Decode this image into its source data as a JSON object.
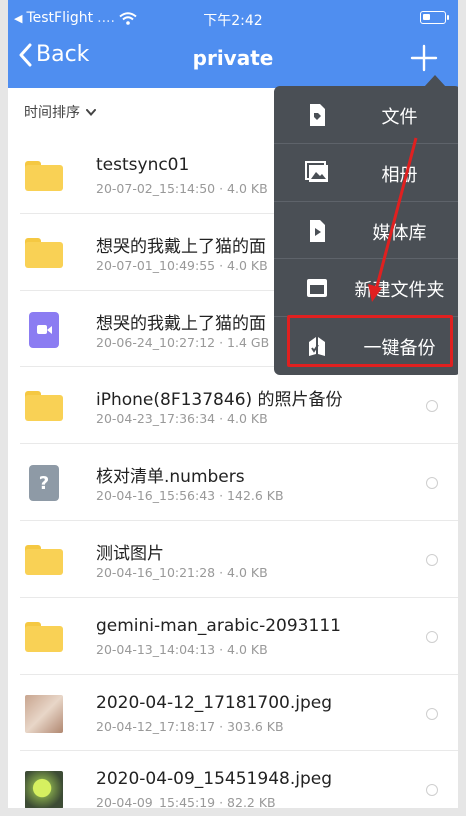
{
  "status_bar": {
    "carrier": "TestFlight",
    "signal": "....",
    "time": "下午2:42"
  },
  "battery": {
    "level": 0.35
  },
  "navbar": {
    "back_label": "Back",
    "title": "private"
  },
  "sort": {
    "label": "时间排序"
  },
  "files": [
    {
      "name": "testsync01",
      "meta": "20-07-02_15:14:50 · 4.0 KB",
      "kind": "folder"
    },
    {
      "name": "想哭的我戴上了猫的面",
      "meta": "20-07-01_10:49:55 · 4.0 KB",
      "kind": "folder"
    },
    {
      "name": "想哭的我戴上了猫的面",
      "meta": "20-06-24_10:27:12 · 1.4 GB",
      "kind": "video"
    },
    {
      "name": "iPhone(8F137846) 的照片备份",
      "meta": "20-04-23_17:36:34 · 4.0 KB",
      "kind": "folder"
    },
    {
      "name": "核对清单.numbers",
      "meta": "20-04-16_15:56:43 · 142.6 KB",
      "kind": "unknown"
    },
    {
      "name": "测试图片",
      "meta": "20-04-16_10:21:28 · 4.0 KB",
      "kind": "folder"
    },
    {
      "name": "gemini-man_arabic-2093111",
      "meta": "20-04-13_14:04:13 · 4.0 KB",
      "kind": "folder"
    },
    {
      "name": "2020-04-12_17181700.jpeg",
      "meta": "20-04-12_17:18:17 · 303.6 KB",
      "kind": "photo1"
    },
    {
      "name": "2020-04-09_15451948.jpeg",
      "meta": "20-04-09_15:45:19 · 82.2 KB",
      "kind": "photo2"
    }
  ],
  "menu": {
    "items": [
      {
        "label": "文件",
        "icon": "file-tag-icon"
      },
      {
        "label": "相册",
        "icon": "album-icon"
      },
      {
        "label": "媒体库",
        "icon": "media-library-icon"
      },
      {
        "label": "新建文件夹",
        "icon": "new-folder-icon"
      },
      {
        "label": "一键备份",
        "icon": "backup-icon"
      }
    ]
  },
  "colors": {
    "header": "#4f8ef0",
    "menu": "#4a4f55",
    "annotation": "#e02020",
    "folder": "#f9d155"
  }
}
